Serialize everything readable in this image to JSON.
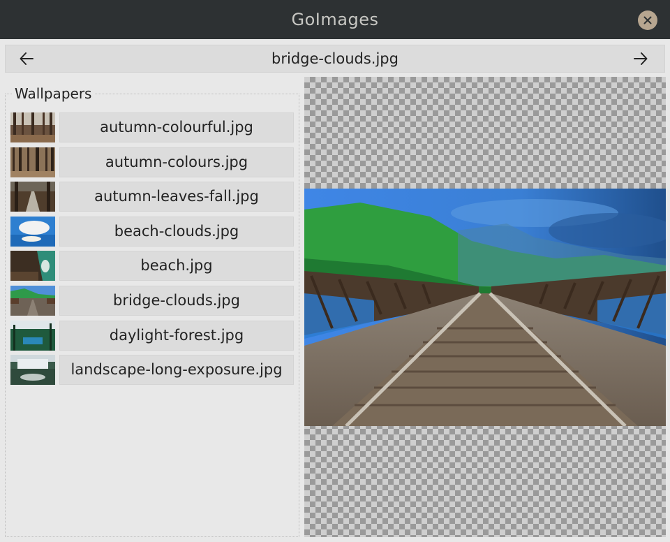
{
  "window": {
    "title": "GoImages",
    "close_icon": "close-icon"
  },
  "navbar": {
    "prev_icon": "arrow-left-icon",
    "current_file": "bridge-clouds.jpg",
    "next_icon": "arrow-right-icon"
  },
  "sidebar": {
    "group_title": "Wallpapers",
    "items": [
      {
        "label": "autumn-colourful.jpg"
      },
      {
        "label": "autumn-colours.jpg"
      },
      {
        "label": "autumn-leaves-fall.jpg"
      },
      {
        "label": "beach-clouds.jpg"
      },
      {
        "label": "beach.jpg"
      },
      {
        "label": "bridge-clouds.jpg"
      },
      {
        "label": "daylight-forest.jpg"
      },
      {
        "label": "landscape-long-exposure.jpg"
      }
    ]
  },
  "colors": {
    "titlebar_bg": "#2d3133",
    "title_text": "#c7c7c3",
    "close_button": "#b7a690",
    "panel_bg": "#e8e8e8",
    "button_bg": "#dcdcdc"
  }
}
